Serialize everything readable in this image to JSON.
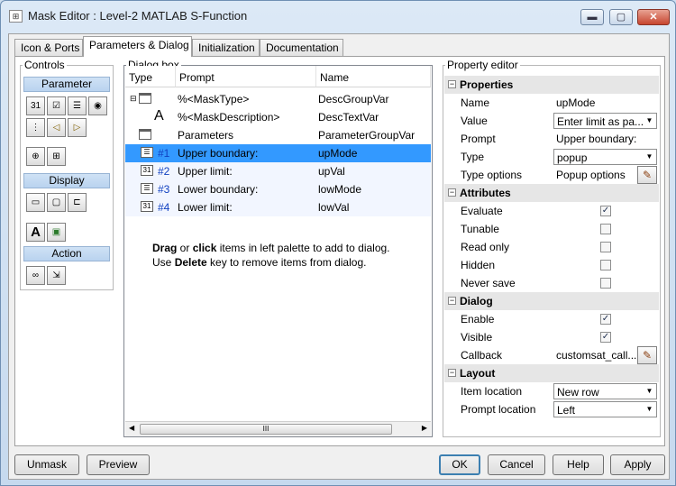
{
  "window": {
    "title": "Mask Editor : Level-2 MATLAB S-Function",
    "app_icon": "mask-editor-icon"
  },
  "title_buttons": {
    "minimize": "▬",
    "maximize": "▢",
    "close": "✕"
  },
  "tabs": [
    "Icon & Ports",
    "Parameters & Dialog",
    "Initialization",
    "Documentation"
  ],
  "controls": {
    "title": "Controls",
    "sections": {
      "parameter": "Parameter",
      "display": "Display",
      "action": "Action"
    },
    "icons": {
      "display_text": "A"
    }
  },
  "dialog_box": {
    "title": "Dialog box",
    "columns": [
      "Type",
      "Prompt",
      "Name"
    ],
    "rows": [
      {
        "num": "",
        "prompt": "%<MaskType>",
        "name": "DescGroupVar"
      },
      {
        "num": "",
        "prompt": "%<MaskDescription>",
        "name": "DescTextVar",
        "type_glyph": "A"
      },
      {
        "num": "",
        "prompt": "Parameters",
        "name": "ParameterGroupVar"
      },
      {
        "num": "#1",
        "prompt": "Upper boundary:",
        "name": "upMode"
      },
      {
        "num": "#2",
        "prompt": "Upper limit:",
        "name": "upVal"
      },
      {
        "num": "#3",
        "prompt": "Lower boundary:",
        "name": "lowMode"
      },
      {
        "num": "#4",
        "prompt": "Lower limit:",
        "name": "lowVal"
      }
    ],
    "hint": {
      "drag": "Drag",
      "or": " or ",
      "click": "click",
      "rest1": " items in left palette to add to dialog.",
      "use": "Use ",
      "delete": "Delete",
      "rest2": " key to remove items from dialog."
    },
    "scroll_thumb": "III"
  },
  "property_editor": {
    "title": "Property editor",
    "categories": {
      "properties": "Properties",
      "attributes": "Attributes",
      "dialog": "Dialog",
      "layout": "Layout"
    },
    "collapse_glyph": "−",
    "properties": {
      "name": {
        "label": "Name",
        "value": "upMode"
      },
      "value": {
        "label": "Value",
        "value": "Enter limit as pa..."
      },
      "prompt": {
        "label": "Prompt",
        "value": "Upper boundary:"
      },
      "type": {
        "label": "Type",
        "value": "popup"
      },
      "type_options": {
        "label": "Type options",
        "value": "Popup options"
      }
    },
    "attributes": {
      "evaluate": {
        "label": "Evaluate",
        "checked": true
      },
      "tunable": {
        "label": "Tunable",
        "checked": false
      },
      "read_only": {
        "label": "Read only",
        "checked": false
      },
      "hidden": {
        "label": "Hidden",
        "checked": false
      },
      "never_save": {
        "label": "Never save",
        "checked": false
      }
    },
    "dialog": {
      "enable": {
        "label": "Enable",
        "checked": true
      },
      "visible": {
        "label": "Visible",
        "checked": true
      },
      "callback": {
        "label": "Callback",
        "value": "customsat_call..."
      }
    },
    "layout": {
      "item_location": {
        "label": "Item location",
        "value": "New row"
      },
      "prompt_location": {
        "label": "Prompt location",
        "value": "Left"
      }
    }
  },
  "buttons": {
    "unmask": "Unmask",
    "preview": "Preview",
    "ok": "OK",
    "cancel": "Cancel",
    "help": "Help",
    "apply": "Apply"
  },
  "colors": {
    "selection": "#3399ff",
    "param_num": "#1040c0"
  }
}
